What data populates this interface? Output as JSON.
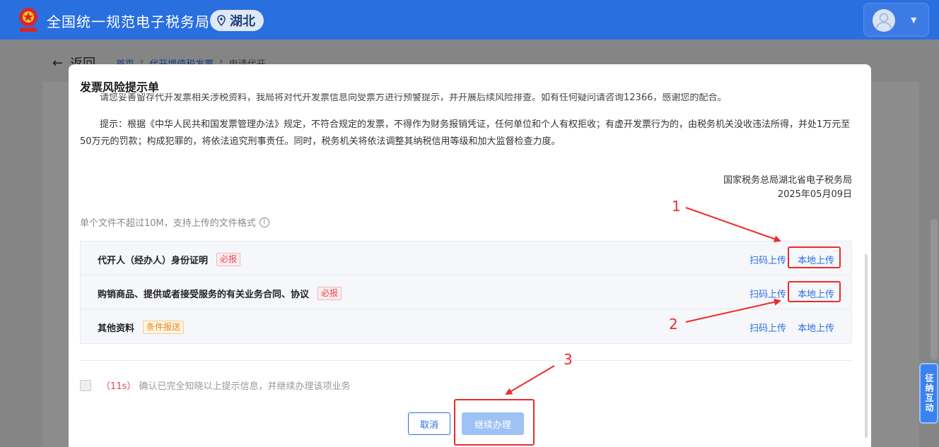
{
  "header": {
    "site_title": "全国统一规范电子税务局",
    "region": "湖北"
  },
  "page": {
    "back_label": "返回",
    "breadcrumbs": [
      "首页",
      "代开增值税发票",
      "申请代开"
    ]
  },
  "modal": {
    "title": "发票风险提示单",
    "clipped_line": "请您妥善留存代开发票相关涉税资料，我局将对代开发票信息向受票方进行预警提示，并开展后续风险排查。如有任何疑问请咨询12366，感谢您的配合。",
    "paragraph": "提示：根据《中华人民共和国发票管理办法》规定，不符合规定的发票，不得作为财务报销凭证，任何单位和个人有权拒收；有虚开发票行为的，由税务机关没收违法所得，并处1万元至50万元的罚款；构成犯罪的，将依法追究刑事责任。同时，税务机关将依法调整其纳税信用等级和加大监督检查力度。",
    "sign_org": "国家税务总局湖北省电子税务局",
    "sign_date": "2025年05月09日",
    "upload_hint": "单个文件不超过10M，支持上传的文件格式",
    "rows": [
      {
        "label": "代开人（经办人）身份证明",
        "tag": "必报",
        "scan": "扫码上传",
        "local": "本地上传"
      },
      {
        "label": "购销商品、提供或者接受服务的有关业务合同、协议",
        "tag": "必报",
        "scan": "扫码上传",
        "local": "本地上传"
      },
      {
        "label": "其他资料",
        "tag": "条件报送",
        "scan": "扫码上传",
        "local": "本地上传"
      }
    ],
    "countdown": "（11s）",
    "confirm_text": "确认已完全知晓以上提示信息，并继续办理该项业务",
    "cancel_label": "取消",
    "continue_label": "继续办理"
  },
  "side_tab": "征纳互动",
  "annotations": [
    "1",
    "2",
    "3"
  ],
  "colors": {
    "primary": "#2a6fe0",
    "annotation": "#ee2a2a",
    "required": "#e5484d",
    "conditional": "#e28a1c"
  }
}
